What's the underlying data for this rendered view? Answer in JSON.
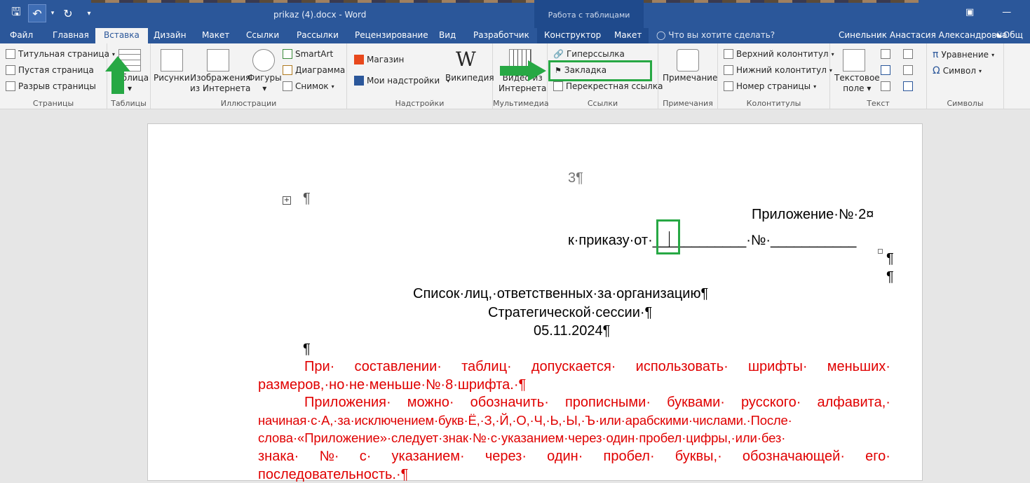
{
  "window": {
    "doc_title": "prikaz (4).docx - Word",
    "contextual_group": "Работа с таблицами",
    "accent": "#2b579a"
  },
  "tabs": [
    "Файл",
    "Главная",
    "Вставка",
    "Дизайн",
    "Макет",
    "Ссылки",
    "Рассылки",
    "Рецензирование",
    "Вид",
    "Разработчик",
    "Конструктор",
    "Макет"
  ],
  "active_tab": "Вставка",
  "tell_me": "Что вы хотите сделать?",
  "user_name": "Синельник Анастасия Александровна",
  "share_label": "Общ",
  "ribbon": {
    "pages": {
      "label": "Страницы",
      "items": [
        "Титульная страница",
        "Пустая страница",
        "Разрыв страницы"
      ]
    },
    "tables": {
      "label": "Таблицы",
      "button": "Таблица"
    },
    "illustrations": {
      "label": "Иллюстрации",
      "pictures": "Рисунки",
      "online_pictures_1": "Изображения",
      "online_pictures_2": "из Интернета",
      "shapes": "Фигуры",
      "smartart": "SmartArt",
      "chart": "Диаграмма",
      "screenshot": "Снимок"
    },
    "addins": {
      "label": "Надстройки",
      "store": "Магазин",
      "my_addins": "Мои надстройки",
      "wikipedia": "Википедия"
    },
    "media": {
      "label": "Мультимедиа",
      "video_1": "Видео из",
      "video_2": "Интернета"
    },
    "links": {
      "label": "Ссылки",
      "hyperlink": "Гиперссылка",
      "bookmark": "Закладка",
      "crossref": "Перекрестная ссылка"
    },
    "comments": {
      "label": "Примечания",
      "comment": "Примечание"
    },
    "header_footer": {
      "label": "Колонтитулы",
      "header": "Верхний колонтитул",
      "footer": "Нижний колонтитул",
      "page_number": "Номер страницы"
    },
    "text": {
      "label": "Текст",
      "textbox_1": "Текстовое",
      "textbox_2": "поле"
    },
    "symbols": {
      "label": "Символы",
      "equation": "Уравнение",
      "symbol": "Символ"
    }
  },
  "document": {
    "page_num": "3¶",
    "pilcrow": "¶",
    "appendix": "Приложение·№·2¤",
    "order_prefix": "к·приказу·от·",
    "order_date_blank": "____________",
    "order_no": "·№·",
    "order_no_blank": "___________",
    "title_1": "Список·лиц,·ответственных·за·организацию¶",
    "title_2": "Стратегической·сессии·¶",
    "title_3": "05.11.2024¶",
    "para1_l1_words": [
      "При·",
      "составлении·",
      "таблиц·",
      "допускается·",
      "использовать·",
      "шрифты·",
      "меньших·"
    ],
    "para1_l2": "размеров,·но·не·меньше·№·8·шрифта.·¶",
    "para2_l1_words": [
      "Приложения·",
      "можно·",
      "обозначить·",
      "прописными·",
      "буквами·",
      "русского·",
      "алфавита,·"
    ],
    "para2_l2": "начиная·с·А,·за·исключением·букв·Ё,·З,·Й,·О,·Ч,·Ь,·Ы,·Ъ·или·арабскими·числами.·После·",
    "para2_l3": "слова·«Приложение»·следует·знак·№·с·указанием·через·один·пробел·цифры,·или·без·",
    "para2_l4_words": [
      "знака·",
      "№·",
      "с·",
      "указанием·",
      "через·",
      "один·",
      "пробел·",
      "буквы,·",
      "обозначающей·",
      "его·"
    ],
    "para2_l5": "последовательность.·¶"
  }
}
